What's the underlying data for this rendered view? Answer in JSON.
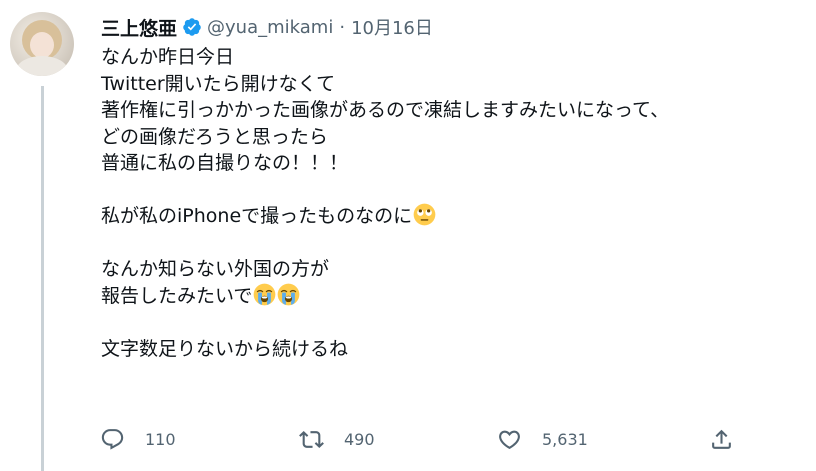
{
  "tweet": {
    "display_name": "三上悠亜",
    "verified": true,
    "handle": "@yua_mikami",
    "separator": "·",
    "date": "10月16日",
    "lines": [
      {
        "text": "なんか昨日今日",
        "emoji": []
      },
      {
        "text": "Twitter開いたら開けなくて",
        "emoji": []
      },
      {
        "text": "著作権に引っかかった画像があるので凍結しますみたいになって、",
        "emoji": []
      },
      {
        "text": "どの画像だろうと思ったら",
        "emoji": []
      },
      {
        "text": "普通に私の自撮りなの！！！",
        "emoji": []
      },
      {
        "text": "",
        "emoji": []
      },
      {
        "text": "私が私のiPhoneで撮ったものなのに",
        "emoji": [
          "face-with-rolling-eyes"
        ]
      },
      {
        "text": "",
        "emoji": []
      },
      {
        "text": "なんか知らない外国の方が",
        "emoji": []
      },
      {
        "text": "報告したみたいで",
        "emoji": [
          "loudly-crying-face",
          "loudly-crying-face"
        ]
      },
      {
        "text": "",
        "emoji": []
      },
      {
        "text": "文字数足りないから続けるね",
        "emoji": []
      }
    ]
  },
  "actions": {
    "reply": {
      "icon": "reply-icon",
      "count": "110"
    },
    "retweet": {
      "icon": "retweet-icon",
      "count": "490"
    },
    "like": {
      "icon": "heart-icon",
      "count": "5,631"
    },
    "share": {
      "icon": "share-icon"
    }
  },
  "colors": {
    "text": "#0f1419",
    "secondary": "#536471",
    "verified": "#1d9bf0",
    "thread_line": "#c9d1d6"
  }
}
